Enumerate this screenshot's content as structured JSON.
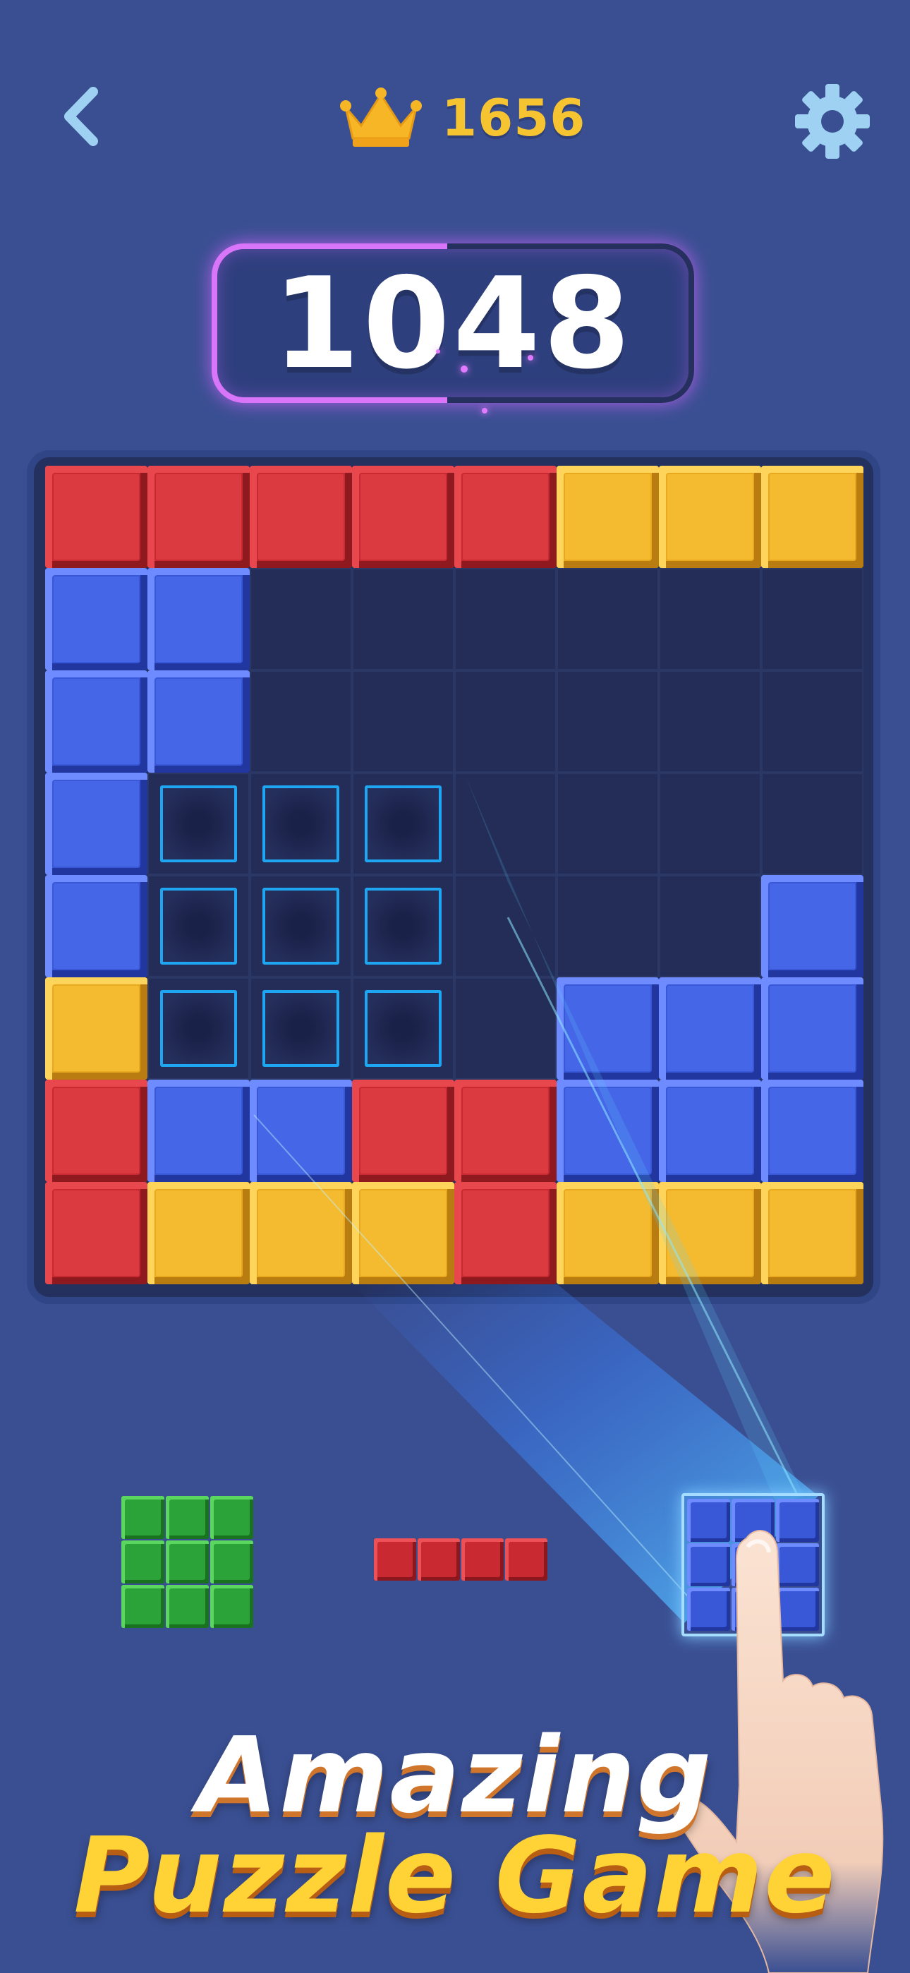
{
  "header": {
    "best_score": "1656",
    "back_icon": "chevron-left-icon",
    "crown_icon": "crown-icon",
    "settings_icon": "gear-icon"
  },
  "score": "1048",
  "colors": {
    "background": "#3a4f92",
    "red": "#c92a32",
    "yellow": "#e9a91f",
    "blue": "#3858d8",
    "green": "#2ba338",
    "ghost_outline": "#1ea6f2",
    "score_glow": "#e07aff",
    "best_score": "#f6c431"
  },
  "board": {
    "size": 8,
    "rows": [
      [
        "red",
        "red",
        "red",
        "red",
        "red",
        "yellow",
        "yellow",
        "yellow"
      ],
      [
        "blue",
        "blue",
        "empty",
        "empty",
        "empty",
        "empty",
        "empty",
        "empty"
      ],
      [
        "blue",
        "blue",
        "empty",
        "empty",
        "empty",
        "empty",
        "empty",
        "empty"
      ],
      [
        "blue",
        "ghost",
        "ghost",
        "ghost",
        "empty",
        "empty",
        "empty",
        "empty"
      ],
      [
        "blue",
        "ghost",
        "ghost",
        "ghost",
        "empty",
        "empty",
        "empty",
        "blue"
      ],
      [
        "yellow",
        "ghost",
        "ghost",
        "ghost",
        "empty",
        "blue",
        "blue",
        "blue"
      ],
      [
        "red",
        "blue",
        "blue",
        "red",
        "red",
        "blue",
        "blue",
        "blue"
      ],
      [
        "red",
        "yellow",
        "yellow",
        "yellow",
        "red",
        "yellow",
        "yellow",
        "yellow"
      ]
    ]
  },
  "pieces": [
    {
      "name": "green-3x3",
      "color": "green",
      "rows": 3,
      "cols": 3
    },
    {
      "name": "red-1x4",
      "color": "red",
      "rows": 1,
      "cols": 4
    },
    {
      "name": "blue-3x3-selected",
      "color": "blue",
      "rows": 3,
      "cols": 3
    }
  ],
  "tagline": {
    "line1": "Amazing",
    "line2": "Puzzle Game"
  }
}
